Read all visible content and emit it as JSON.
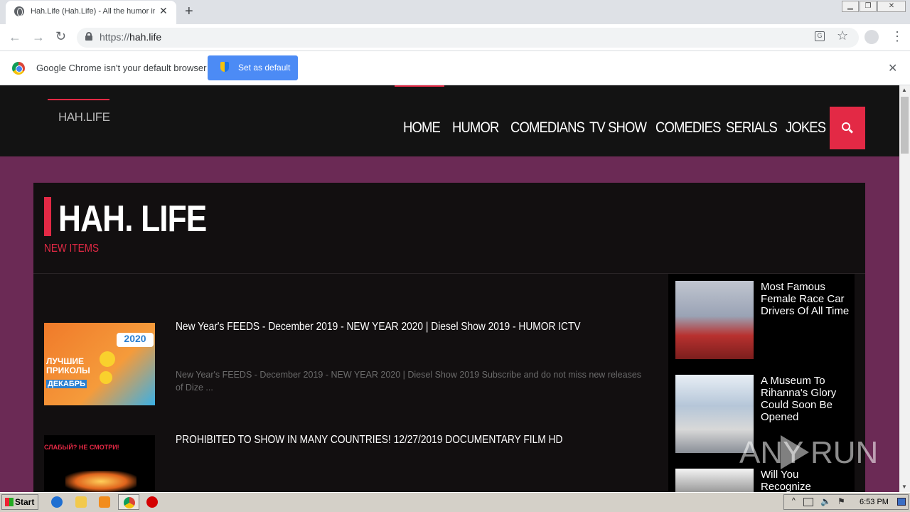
{
  "browser": {
    "tab_title": "Hah.Life (Hah.Life) - All the humor in",
    "tab_close": "✕",
    "new_tab": "+",
    "url_scheme": "https://",
    "url_host": "hah.life",
    "back_icon": "←",
    "forward_icon": "→",
    "reload_icon": "↻",
    "window_minimize": "▁",
    "window_restore": "❐",
    "window_close": "✕"
  },
  "infobar": {
    "message": "Google Chrome isn't your default browser",
    "set_default_label": "Set as default",
    "close": "✕"
  },
  "site": {
    "logo": "HAH.LIFE",
    "nav": [
      "HOME",
      "HUMOR",
      "COMEDIANS",
      "TV SHOW",
      "COMEDIES",
      "SERIALS",
      "JOKES"
    ],
    "page_title": "HAH. LIFE",
    "subtitle": "NEW ITEMS",
    "accent_color": "#e32945",
    "background_color": "#6b2a55"
  },
  "posts": [
    {
      "title": "New Year's FEEDS - December 2019 - NEW YEAR 2020 | Diesel Show 2019 - HUMOR ICTV",
      "excerpt": "New Year's FEEDS - December 2019 - NEW YEAR 2020 | Diesel Show 2019 Subscribe and do not miss new releases of Dize ...",
      "thumb_text": [
        "2020",
        "ЛУЧШИЕ",
        "ПРИКОЛЫ",
        "ДЕКАБРЬ"
      ]
    },
    {
      "title": "PROHIBITED TO SHOW IN MANY COUNTRIES! 12/27/2019 DOCUMENTARY FILM HD",
      "thumb_text": [
        "СЛАБЫЙ? НЕ СМОТРИ!"
      ]
    }
  ],
  "sidebar": [
    {
      "title": "Most Famous Female Race Car Drivers Of All Time"
    },
    {
      "title": "A Museum To Rihanna's Glory Could Soon Be Opened"
    },
    {
      "title": "Will You Recognize"
    }
  ],
  "watermark": {
    "left": "ANY",
    "right": "RUN"
  },
  "taskbar": {
    "start_label": "Start",
    "clock": "6:53 PM"
  }
}
